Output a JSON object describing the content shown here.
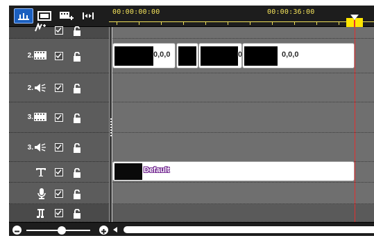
{
  "toolbar": {
    "buttons": [
      {
        "name": "timeline-view",
        "icon": "timeline-icon",
        "active": true
      },
      {
        "name": "storyboard-view",
        "icon": "storyboard-icon",
        "active": false
      },
      {
        "name": "add-track",
        "icon": "add-track-icon",
        "active": false
      },
      {
        "name": "fit-to-window",
        "icon": "fit-width-icon",
        "active": false
      }
    ]
  },
  "ruler": {
    "timecode_start": "00:00:00:00",
    "timecode_mid": "00:00:36:00"
  },
  "tracks": [
    {
      "type": "effects",
      "number": "",
      "icon": "effects-icon",
      "enabled": true,
      "locked": false
    },
    {
      "type": "video",
      "number": "2.",
      "icon": "film-icon",
      "enabled": true,
      "locked": false
    },
    {
      "type": "audio",
      "number": "2.",
      "icon": "speaker-icon",
      "enabled": true,
      "locked": false
    },
    {
      "type": "video",
      "number": "3.",
      "icon": "film-icon",
      "enabled": true,
      "locked": false
    },
    {
      "type": "audio",
      "number": "3.",
      "icon": "speaker-icon",
      "enabled": true,
      "locked": false
    },
    {
      "type": "title",
      "number": "",
      "icon": "text-icon",
      "enabled": true,
      "locked": false
    },
    {
      "type": "voice",
      "number": "",
      "icon": "microphone-icon",
      "enabled": true,
      "locked": false
    },
    {
      "type": "music",
      "number": "",
      "icon": "music-note-icon",
      "enabled": true,
      "locked": false
    }
  ],
  "clips": {
    "video2": [
      {
        "label": "0,0,0"
      },
      {
        "label": ""
      },
      {
        "label": "0"
      },
      {
        "label": "0,0,0"
      }
    ],
    "title": {
      "label": "Default"
    }
  },
  "zoom": {
    "level": 0.55
  },
  "colors": {
    "accent": "#1b5fbf",
    "timecode": "#f3e25a",
    "playhead": "#e53030",
    "marker": "#ffe600"
  }
}
